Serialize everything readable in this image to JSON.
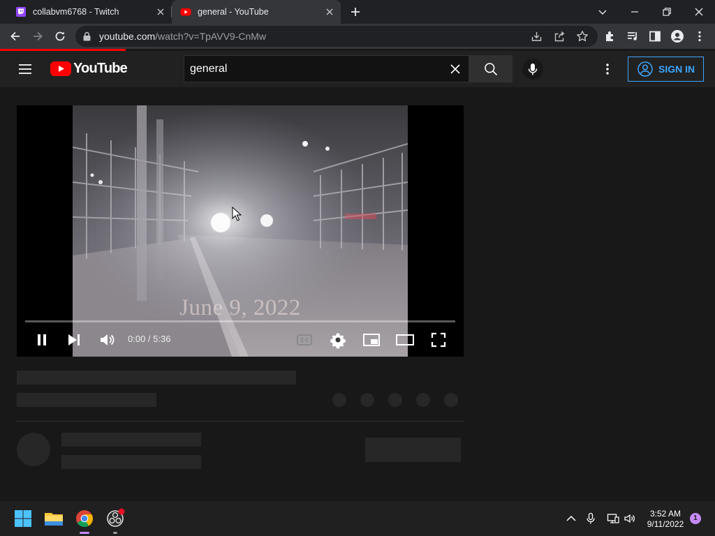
{
  "browser": {
    "tabs": [
      {
        "title": "collabvm6768 - Twitch",
        "icon": "twitch-icon",
        "active": false
      },
      {
        "title": "general - YouTube",
        "icon": "youtube-icon",
        "active": true
      }
    ],
    "url_host": "youtube.com",
    "url_rest": "/watch?v=TpAVV9-CnMw"
  },
  "youtube": {
    "logo_text": "YouTube",
    "search_value": "general",
    "sign_in_label": "SIGN IN"
  },
  "player": {
    "overlay_text": "June 9, 2022",
    "time_current": "0:00",
    "time_total": "5:36",
    "time_display": "0:00 / 5:36",
    "progress": 0,
    "state": "playing"
  },
  "taskbar": {
    "time": "3:52 AM",
    "date": "9/11/2022",
    "notification_count": "1"
  },
  "colors": {
    "accent_blue": "#3ea6ff",
    "youtube_red": "#ff0000",
    "background": "#181818",
    "masthead": "#212121"
  }
}
